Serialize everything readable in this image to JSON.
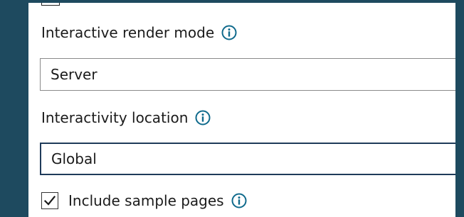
{
  "colors": {
    "background": "#1e4a5f",
    "panel": "#ffffff",
    "info_icon": "#0f6a8c",
    "focused_border": "#1f3b5a",
    "default_border": "#8a8a8a"
  },
  "render_mode": {
    "label": "Interactive render mode",
    "value": "Server",
    "icon": "info-icon"
  },
  "interactivity_location": {
    "label": "Interactivity location",
    "value": "Global",
    "icon": "info-icon"
  },
  "sample_pages": {
    "label": "Include sample pages",
    "checked": true,
    "icon": "info-icon"
  }
}
